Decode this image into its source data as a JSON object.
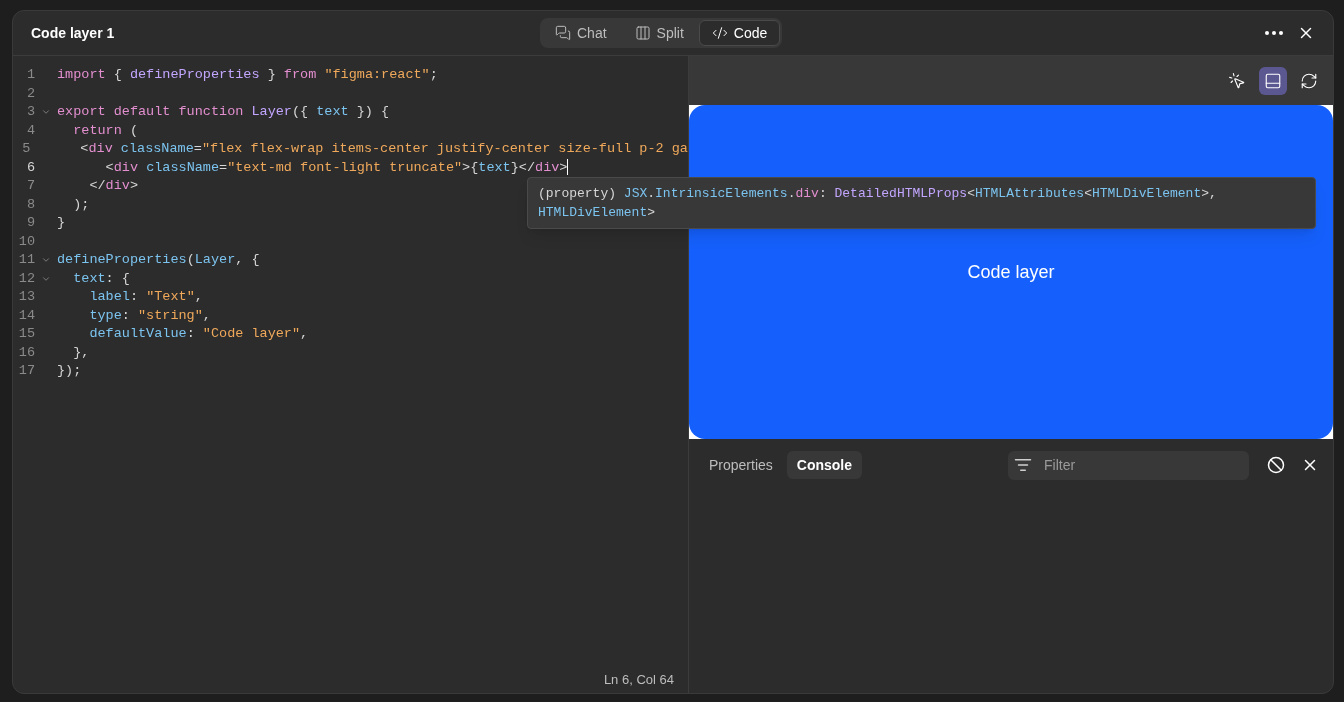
{
  "window": {
    "title": "Code layer 1"
  },
  "view_tabs": [
    {
      "label": "Chat",
      "selected": false
    },
    {
      "label": "Split",
      "selected": false
    },
    {
      "label": "Code",
      "selected": true
    }
  ],
  "editor": {
    "lines": [
      {
        "number": "1",
        "foldable": false,
        "current": false,
        "tokens": [
          {
            "kind": "kw",
            "text": "import"
          },
          {
            "kind": "plain",
            "text": " { "
          },
          {
            "kind": "fn",
            "text": "defineProperties"
          },
          {
            "kind": "plain",
            "text": " } "
          },
          {
            "kind": "kw",
            "text": "from "
          },
          {
            "kind": "str",
            "text": "\"figma:react\""
          },
          {
            "kind": "plain",
            "text": ";"
          }
        ]
      },
      {
        "number": "2",
        "foldable": false,
        "current": false
      },
      {
        "number": "3",
        "foldable": true,
        "current": false,
        "tokens": [
          {
            "kind": "kw",
            "text": "export default function"
          },
          {
            "kind": "fn",
            "text": " Layer"
          },
          {
            "kind": "plain",
            "text": "({ "
          },
          {
            "kind": "prop",
            "text": "text"
          },
          {
            "kind": "plain",
            "text": " }) {"
          }
        ]
      },
      {
        "number": "4",
        "foldable": false,
        "current": false,
        "tokens": [
          {
            "kind": "kw",
            "text": "  return"
          },
          {
            "kind": "plain",
            "text": " ("
          }
        ]
      },
      {
        "number": "5",
        "foldable": false,
        "current": false,
        "tokens": [
          {
            "kind": "plain",
            "text": "    <"
          },
          {
            "kind": "kw",
            "text": "div"
          },
          {
            "kind": "prop",
            "text": " className"
          },
          {
            "kind": "plain",
            "text": "="
          },
          {
            "kind": "str",
            "text": "\"flex flex-wrap items-center justify-center size-full p-2 ga"
          }
        ]
      },
      {
        "number": "6",
        "foldable": false,
        "current": true,
        "tokens": [
          {
            "kind": "plain",
            "text": "      <"
          },
          {
            "kind": "kw",
            "text": "div"
          },
          {
            "kind": "prop",
            "text": " className"
          },
          {
            "kind": "plain",
            "text": "="
          },
          {
            "kind": "str",
            "text": "\"text-md font-light truncate\""
          },
          {
            "kind": "plain",
            "text": ">{"
          },
          {
            "kind": "prop",
            "text": "text"
          },
          {
            "kind": "plain",
            "text": "}</"
          },
          {
            "kind": "kw",
            "text": "div"
          },
          {
            "kind": "plain",
            "text": ">"
          }
        ]
      },
      {
        "number": "7",
        "foldable": false,
        "current": false,
        "tokens": [
          {
            "kind": "plain",
            "text": "    </"
          },
          {
            "kind": "kw",
            "text": "div"
          },
          {
            "kind": "plain",
            "text": ">"
          }
        ]
      },
      {
        "number": "8",
        "foldable": false,
        "current": false,
        "tokens": [
          {
            "kind": "plain",
            "text": "  );"
          }
        ]
      },
      {
        "number": "9",
        "foldable": false,
        "current": false,
        "tokens": [
          {
            "kind": "plain",
            "text": "}"
          }
        ]
      },
      {
        "number": "10",
        "foldable": false,
        "current": false
      },
      {
        "number": "11",
        "foldable": true,
        "current": false,
        "tokens": [
          {
            "kind": "prop",
            "text": "defineProperties"
          },
          {
            "kind": "plain",
            "text": "("
          },
          {
            "kind": "prop",
            "text": "Layer"
          },
          {
            "kind": "plain",
            "text": ", {"
          }
        ]
      },
      {
        "number": "12",
        "foldable": true,
        "current": false,
        "tokens": [
          {
            "kind": "prop",
            "text": "  text"
          },
          {
            "kind": "plain",
            "text": ": {"
          }
        ]
      },
      {
        "number": "13",
        "foldable": false,
        "current": false,
        "tokens": [
          {
            "kind": "prop",
            "text": "    label"
          },
          {
            "kind": "plain",
            "text": ": "
          },
          {
            "kind": "str",
            "text": "\"Text\""
          },
          {
            "kind": "plain",
            "text": ","
          }
        ]
      },
      {
        "number": "14",
        "foldable": false,
        "current": false,
        "tokens": [
          {
            "kind": "prop",
            "text": "    type"
          },
          {
            "kind": "plain",
            "text": ": "
          },
          {
            "kind": "str",
            "text": "\"string\""
          },
          {
            "kind": "plain",
            "text": ","
          }
        ]
      },
      {
        "number": "15",
        "foldable": false,
        "current": false,
        "tokens": [
          {
            "kind": "prop",
            "text": "    defaultValue"
          },
          {
            "kind": "plain",
            "text": ": "
          },
          {
            "kind": "str",
            "text": "\"Code layer\""
          },
          {
            "kind": "plain",
            "text": ","
          }
        ]
      },
      {
        "number": "16",
        "foldable": false,
        "current": false,
        "tokens": [
          {
            "kind": "plain",
            "text": "  },"
          }
        ]
      },
      {
        "number": "17",
        "foldable": false,
        "current": false,
        "tokens": [
          {
            "kind": "plain",
            "text": "});"
          }
        ]
      }
    ],
    "tooltip": {
      "tokens": [
        {
          "kind": "plain",
          "text": "(property) "
        },
        {
          "kind": "prop",
          "text": "JSX"
        },
        {
          "kind": "plain",
          "text": "."
        },
        {
          "kind": "prop",
          "text": "IntrinsicElements"
        },
        {
          "kind": "plain",
          "text": "."
        },
        {
          "kind": "kw",
          "text": "div"
        },
        {
          "kind": "plain",
          "text": ": "
        },
        {
          "kind": "fn",
          "text": "DetailedHTMLProps"
        },
        {
          "kind": "plain",
          "text": "<"
        },
        {
          "kind": "prop",
          "text": "HTMLAttributes"
        },
        {
          "kind": "plain",
          "text": "<"
        },
        {
          "kind": "prop",
          "text": "HTMLDivElement"
        },
        {
          "kind": "plain",
          "text": ">, "
        },
        {
          "kind": "prop",
          "text": "HTMLDivElement"
        },
        {
          "kind": "plain",
          "text": ">"
        }
      ]
    },
    "status": "Ln 6, Col 64"
  },
  "preview": {
    "toolbar": [
      {
        "selected": false
      },
      {
        "selected": true
      },
      {
        "selected": false
      }
    ],
    "text": "Code layer"
  },
  "bottom_panel": {
    "tabs": [
      {
        "label": "Properties",
        "selected": false
      },
      {
        "label": "Console",
        "selected": true
      }
    ],
    "filter": {
      "placeholder": "Filter"
    }
  }
}
